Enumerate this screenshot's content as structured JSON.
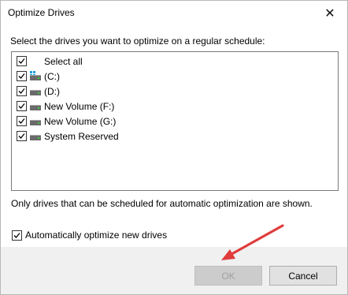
{
  "dialog": {
    "title": "Optimize Drives",
    "close_glyph": "✕",
    "instruction": "Select the drives you want to optimize on a regular schedule:",
    "note": "Only drives that can be scheduled for automatic optimization are shown.",
    "auto_optimize_label": "Automatically optimize new drives",
    "auto_optimize_checked": true
  },
  "drives": {
    "select_all": "Select all",
    "items": [
      {
        "label": "(C:)",
        "icon": "system-drive-icon",
        "checked": true
      },
      {
        "label": "(D:)",
        "icon": "drive-icon",
        "checked": true
      },
      {
        "label": "New Volume (F:)",
        "icon": "drive-icon",
        "checked": true
      },
      {
        "label": "New Volume (G:)",
        "icon": "drive-icon",
        "checked": true
      },
      {
        "label": "System Reserved",
        "icon": "drive-icon",
        "checked": true
      }
    ]
  },
  "footer": {
    "ok_label": "OK",
    "cancel_label": "Cancel"
  },
  "colors": {
    "annotation_arrow": "#e03c3c",
    "ok_disabled_text": "#a0a0a0"
  }
}
